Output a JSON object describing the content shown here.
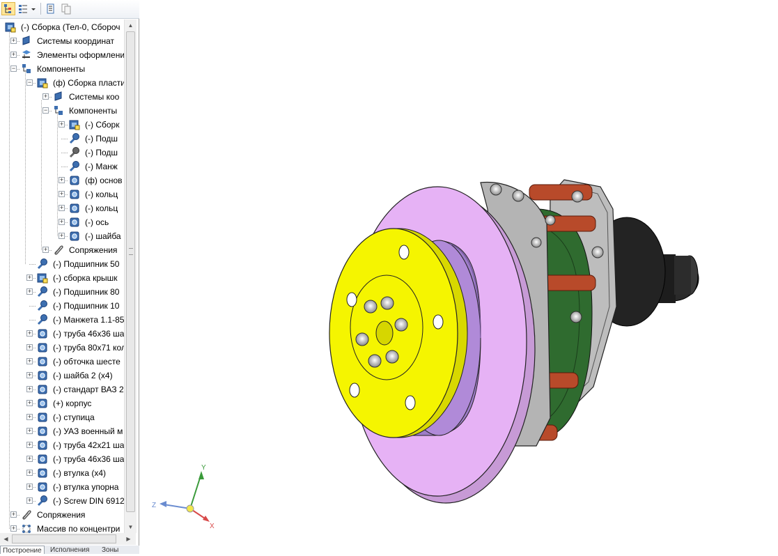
{
  "toolbar": {
    "buttons": [
      "tree-view-icon",
      "list-view-icon",
      "document-icon",
      "copy-icon"
    ]
  },
  "tree": {
    "items": [
      {
        "label": "(-) Сборка (Тел-0, Сбороч",
        "icon": "assembly-icon"
      },
      {
        "label": "Системы координат",
        "icon": "coordinate-system-icon"
      },
      {
        "label": "Элементы оформлени",
        "icon": "annotation-icon"
      },
      {
        "label": "Компоненты",
        "icon": "components-icon"
      },
      {
        "label": "(ф) Сборка пласти",
        "icon": "assembly-icon"
      },
      {
        "label": "Системы коо",
        "icon": "coordinate-system-icon"
      },
      {
        "label": "Компоненты",
        "icon": "components-icon"
      },
      {
        "label": "(-) Сборк",
        "icon": "assembly-icon"
      },
      {
        "label": "(-) Подш",
        "icon": "standard-part-icon"
      },
      {
        "label": "(-) Подш",
        "icon": "standard-part-gray-icon"
      },
      {
        "label": "(-) Манж",
        "icon": "standard-part-icon"
      },
      {
        "label": "(ф) основ",
        "icon": "part-icon"
      },
      {
        "label": "(-) кольц",
        "icon": "part-icon"
      },
      {
        "label": "(-) кольц",
        "icon": "part-icon"
      },
      {
        "label": "(-) ось",
        "icon": "part-icon"
      },
      {
        "label": "(-) шайба",
        "icon": "part-icon"
      },
      {
        "label": "Сопряжения",
        "icon": "mates-icon"
      },
      {
        "label": "(-) Подшипник 50",
        "icon": "standard-part-icon"
      },
      {
        "label": "(-) сборка крышк",
        "icon": "assembly-icon"
      },
      {
        "label": "(-) Подшипник 80",
        "icon": "standard-part-icon"
      },
      {
        "label": "(-) Подшипник 10",
        "icon": "standard-part-icon"
      },
      {
        "label": "(-) Манжета 1.1-85",
        "icon": "standard-part-icon"
      },
      {
        "label": "(-) труба 46х36 ша",
        "icon": "part-icon"
      },
      {
        "label": "(-) труба 80х71 кол",
        "icon": "part-icon"
      },
      {
        "label": "(-) обточка шесте",
        "icon": "part-icon"
      },
      {
        "label": "(-) шайба 2 (х4)",
        "icon": "part-icon"
      },
      {
        "label": "(-) стандарт ВАЗ 2",
        "icon": "part-icon"
      },
      {
        "label": "(+) корпус",
        "icon": "part-icon"
      },
      {
        "label": "(-) ступица",
        "icon": "part-icon"
      },
      {
        "label": "(-) УАЗ военный м",
        "icon": "part-icon"
      },
      {
        "label": "(-) труба 42х21 ша",
        "icon": "part-icon"
      },
      {
        "label": "(-) труба 46х36 ша",
        "icon": "part-icon"
      },
      {
        "label": "(-) втулка (х4)",
        "icon": "part-icon"
      },
      {
        "label": "(-) втулка упорна",
        "icon": "part-icon"
      },
      {
        "label": "(-) Screw DIN 6912",
        "icon": "standard-part-icon"
      },
      {
        "label": "Сопряжения",
        "icon": "mates-icon"
      },
      {
        "label": "Массив по концентри",
        "icon": "pattern-icon"
      }
    ]
  },
  "tabs": [
    {
      "label": "Построение",
      "active": true
    },
    {
      "label": "Исполнения",
      "active": false
    },
    {
      "label": "Зоны",
      "active": false
    }
  ],
  "triad": {
    "x": "X",
    "y": "Y",
    "z": "Z"
  },
  "colors": {
    "disc": "#e6b2f5",
    "hub_face": "#f5f500",
    "hub_side": "#b08ad8",
    "green": "#2f6b2f",
    "red": "#b84a2a",
    "housing": "#1e1e1e",
    "plate": "#b4b4b4",
    "selection": "#ffe79a"
  }
}
